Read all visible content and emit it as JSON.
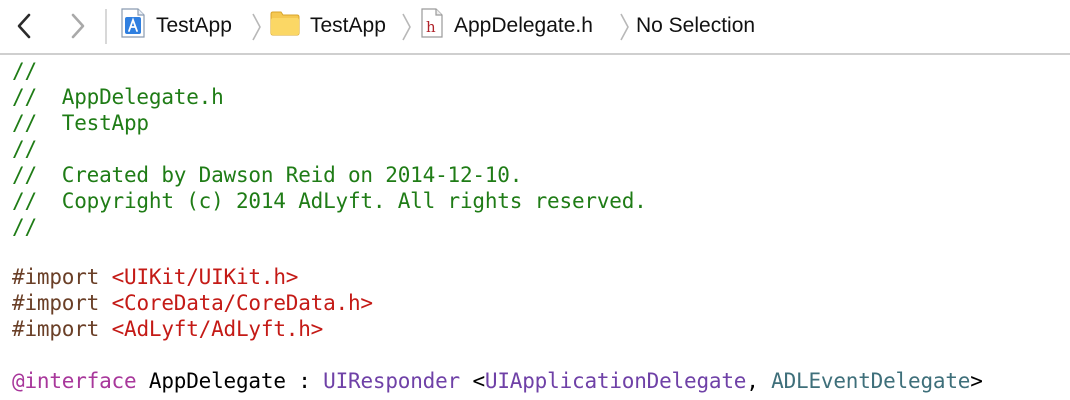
{
  "jumpbar": {
    "back_icon": "chevron-left-icon",
    "forward_icon": "chevron-right-icon",
    "crumbs": [
      {
        "label": "TestApp",
        "icon": "xcode-project-icon"
      },
      {
        "label": "TestApp",
        "icon": "folder-icon"
      },
      {
        "label": "AppDelegate.h",
        "icon": "header-file-icon"
      },
      {
        "label": "No Selection",
        "icon": ""
      }
    ]
  },
  "editor": {
    "lines": [
      {
        "comment": "//"
      },
      {
        "comment": "//  AppDelegate.h"
      },
      {
        "comment": "//  TestApp"
      },
      {
        "comment": "//"
      },
      {
        "comment": "//  Created by Dawson Reid on 2014-12-10."
      },
      {
        "comment": "//  Copyright (c) 2014 AdLyft. All rights reserved."
      },
      {
        "comment": "//"
      },
      {
        "directive": "#import",
        "path": "<UIKit/UIKit.h>"
      },
      {
        "directive": "#import",
        "path": "<CoreData/CoreData.h>"
      },
      {
        "directive": "#import",
        "path": "<AdLyft/AdLyft.h>"
      },
      {
        "keyword": "@interface",
        "class_name": "AppDelegate",
        "colon": ":",
        "superclass": "UIResponder",
        "open": "<",
        "protocol1": "UIApplicationDelegate",
        "comma": ",",
        "protocol2": "ADLEventDelegate",
        "close": ">"
      }
    ]
  },
  "colors": {
    "comment": "#1f7c16",
    "preprocessor": "#6a3f27",
    "string": "#c41a16",
    "keyword": "#a8379b",
    "type": "#6f41a7",
    "protocol": "#3e6f7a"
  }
}
